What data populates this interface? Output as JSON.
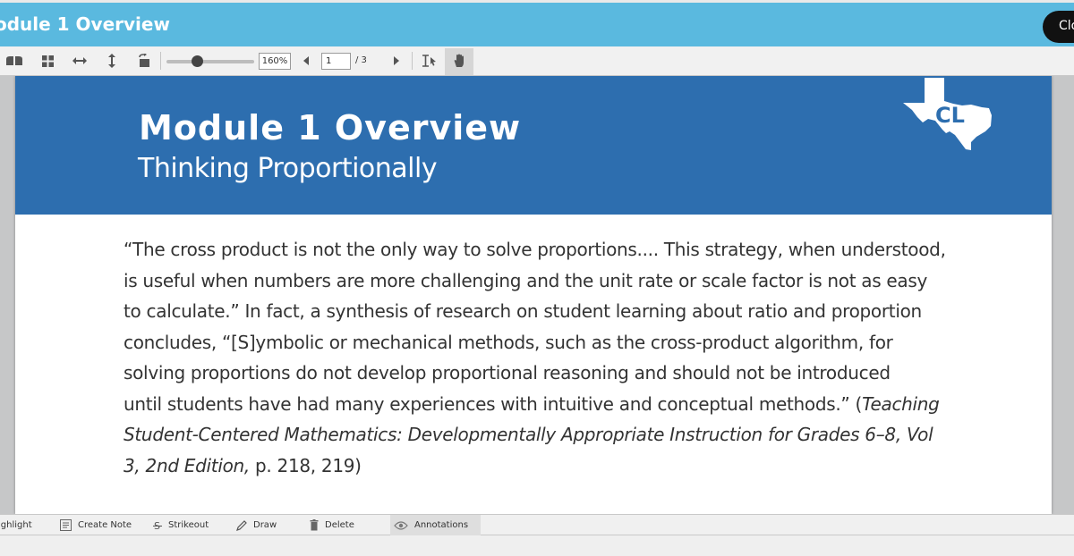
{
  "window": {
    "title": "odule 1 Overview",
    "close_label": "Clo"
  },
  "toolbar": {
    "icons": [
      "two-page-view-icon",
      "grid-view-icon",
      "fit-width-icon",
      "fit-height-icon",
      "rotate-page-icon",
      "text-select-icon",
      "hand-pan-icon"
    ],
    "zoom_slider_fraction": 0.35,
    "zoom_value": "160%",
    "page_current": "1",
    "page_total": "/ 3"
  },
  "document": {
    "banner_title": "Module 1 Overview",
    "banner_subtitle": "Thinking Proportionally",
    "logo_text": "CL",
    "logo_color": "#ffffff",
    "banner_color": "#2d6eaf",
    "quote": {
      "line1": "“The cross product is not the only way to solve proportions.... This strategy, when understood,",
      "line2": "is useful when numbers are more challenging and the unit rate or scale factor is not as easy",
      "line3": "to calculate.” In fact, a synthesis of research on student learning about ratio and proportion",
      "line4": "concludes, “[S]ymbolic or mechanical methods, such as the cross-product algorithm, for",
      "line5": "solving proportions do not develop proportional reasoning and should not be introduced",
      "line6_plain": "until students have had many experiences with intuitive and conceptual methods.” (",
      "line6_italic": "Teaching",
      "line7_italic": "Student-Centered Mathematics: Developmentally Appropriate Instruction for Grades 6–8, Vol",
      "line8_italic": "3, 2nd Edition,",
      "line8_plain": " p. 218, 219)"
    }
  },
  "annotations": {
    "highlight": "ighlight",
    "create_note": "Create Note",
    "strikeout": "Strikeout",
    "draw": "Draw",
    "delete": "Delete",
    "annotations": "Annotations"
  }
}
